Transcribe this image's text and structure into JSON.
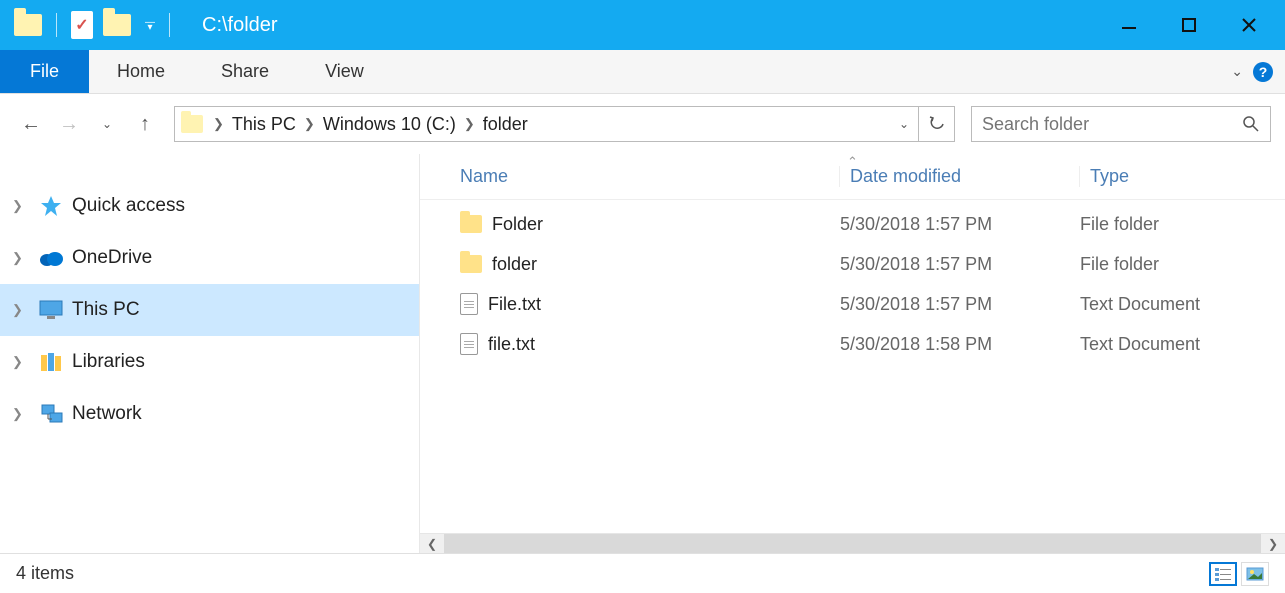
{
  "title": "C:\\folder",
  "ribbon": {
    "file": "File",
    "tabs": [
      "Home",
      "Share",
      "View"
    ]
  },
  "breadcrumbs": [
    "This PC",
    "Windows 10 (C:)",
    "folder"
  ],
  "search": {
    "placeholder": "Search folder"
  },
  "tree": [
    {
      "label": "Quick access",
      "icon": "star"
    },
    {
      "label": "OneDrive",
      "icon": "cloud"
    },
    {
      "label": "This PC",
      "icon": "pc",
      "selected": true
    },
    {
      "label": "Libraries",
      "icon": "libraries"
    },
    {
      "label": "Network",
      "icon": "network"
    }
  ],
  "columns": {
    "name": "Name",
    "modified": "Date modified",
    "type": "Type"
  },
  "files": [
    {
      "name": "Folder",
      "modified": "5/30/2018 1:57 PM",
      "type": "File folder",
      "icon": "folder"
    },
    {
      "name": "folder",
      "modified": "5/30/2018 1:57 PM",
      "type": "File folder",
      "icon": "folder"
    },
    {
      "name": "File.txt",
      "modified": "5/30/2018 1:57 PM",
      "type": "Text Document",
      "icon": "file"
    },
    {
      "name": "file.txt",
      "modified": "5/30/2018 1:58 PM",
      "type": "Text Document",
      "icon": "file"
    }
  ],
  "status": {
    "items": "4 items"
  }
}
